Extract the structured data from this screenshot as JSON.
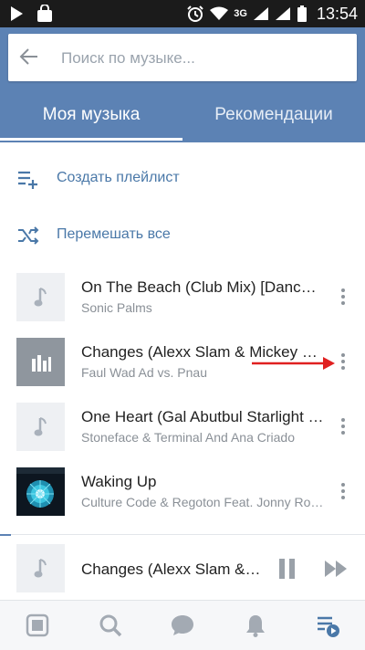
{
  "status_bar": {
    "network": "3G",
    "time": "13:54"
  },
  "search": {
    "placeholder": "Поиск по музыке..."
  },
  "tabs": [
    {
      "label": "Моя музыка",
      "active": true
    },
    {
      "label": "Рекомендации",
      "active": false
    }
  ],
  "actions": {
    "create_playlist": "Создать плейлист",
    "shuffle_all": "Перемешать все"
  },
  "tracks": [
    {
      "title": "On The Beach (Club Mix) [Dance Mix]",
      "artist": "Sonic Palms",
      "cover": "music-note-icon"
    },
    {
      "title": "Changes (Alexx Slam & Mickey Remix)",
      "artist": "Faul Wad Ad vs. Pnau",
      "cover": "equalizer-icon",
      "playing": true
    },
    {
      "title": "One Heart  (Gal Abutbul Starlight Remix)",
      "artist": "Stoneface & Terminal And Ana Criado",
      "cover": "music-note-icon"
    },
    {
      "title": "Waking Up",
      "artist": "Culture Code & Regoton Feat. Jonny Rose",
      "cover": "album-art"
    }
  ],
  "now_playing": {
    "title": "Changes (Alexx Slam & Mickey Remix)",
    "progress_fraction": 0.03
  },
  "colors": {
    "accent": "#5c82b4",
    "link": "#4a78a8",
    "annotation_arrow": "#e02020"
  }
}
